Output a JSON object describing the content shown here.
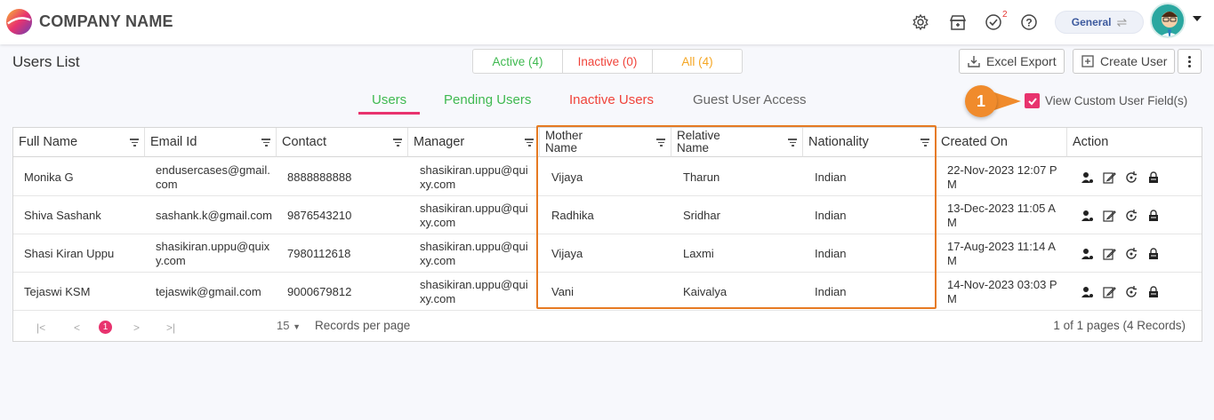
{
  "header": {
    "brand": "COMPANY NAME",
    "notification_count": "2",
    "workspace": "General",
    "icons": [
      "settings-icon",
      "store-icon",
      "tasks-check-icon",
      "help-icon"
    ]
  },
  "page": {
    "title": "Users List"
  },
  "status_filter": [
    {
      "label": "Active (4)",
      "color": "#3fb950"
    },
    {
      "label": "Inactive (0)",
      "color": "#f0433a"
    },
    {
      "label": "All (4)",
      "color": "#f5a623"
    }
  ],
  "toolbar": {
    "excel_export": "Excel Export",
    "create_user": "Create User"
  },
  "tabs": [
    {
      "label": "Users",
      "color": "#3fb950"
    },
    {
      "label": "Pending Users",
      "color": "#3fb950"
    },
    {
      "label": "Inactive Users",
      "color": "#f0433a"
    },
    {
      "label": "Guest User Access",
      "color": "#666666"
    }
  ],
  "callout": {
    "number": "1"
  },
  "custom_fields": {
    "label": "View Custom User Field(s)",
    "checked": true
  },
  "table": {
    "columns": [
      "Full Name",
      "Email Id",
      "Contact",
      "Manager",
      "Mother Name",
      "Relative Name",
      "Nationality",
      "Created On",
      "Action"
    ],
    "rows": [
      {
        "name": "Monika G",
        "email": "endusercases@gmail.com",
        "contact": "8888888888",
        "manager": "shasikiran.uppu@quixy.com",
        "mother": "Vijaya",
        "relative": "Tharun",
        "nationality": "Indian",
        "created": "22-Nov-2023 12:07 PM"
      },
      {
        "name": "Shiva Sashank",
        "email": "sashank.k@gmail.com",
        "contact": "9876543210",
        "manager": "shasikiran.uppu@quixy.com",
        "mother": "Radhika",
        "relative": "Sridhar",
        "nationality": "Indian",
        "created": "13-Dec-2023 11:05 AM"
      },
      {
        "name": "Shasi Kiran Uppu",
        "email": "shasikiran.uppu@quixy.com",
        "contact": "7980112618",
        "manager": "shasikiran.uppu@quixy.com",
        "mother": "Vijaya",
        "relative": "Laxmi",
        "nationality": "Indian",
        "created": "17-Aug-2023 11:14 AM"
      },
      {
        "name": "Tejaswi KSM",
        "email": "tejaswik@gmail.com",
        "contact": "9000679812",
        "manager": "shasikiran.uppu@quixy.com",
        "mother": "Vani",
        "relative": "Kaivalya",
        "nationality": "Indian",
        "created": "14-Nov-2023 03:03 PM"
      }
    ]
  },
  "pagination": {
    "first": "|<",
    "prev": "<",
    "current": "1",
    "next": ">",
    "last": ">|",
    "page_size": "15",
    "per_page_label": "Records per page",
    "info": "1 of 1 pages (4 Records)"
  }
}
